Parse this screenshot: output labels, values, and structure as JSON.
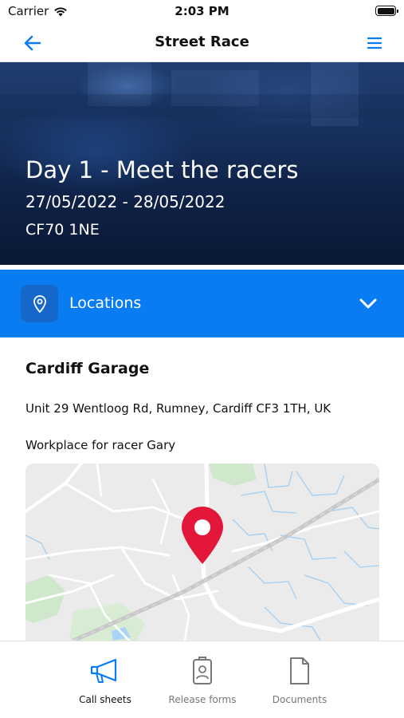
{
  "status_bar": {
    "carrier": "Carrier",
    "time": "2:03 PM"
  },
  "nav": {
    "title": "Street Race",
    "back_icon": "arrow-left-icon",
    "menu_icon": "hamburger-menu-icon"
  },
  "hero": {
    "title": "Day 1 - Meet the racers",
    "dates": "27/05/2022 - 28/05/2022",
    "postcode": "CF70 1NE"
  },
  "section": {
    "label": "Locations",
    "icon": "map-pin-icon",
    "expanded": true,
    "accent_color": "#0a7cf2"
  },
  "location": {
    "name": "Cardiff Garage",
    "address": "Unit 29 Wentloog Rd, Rumney, Cardiff CF3 1TH, UK",
    "note": "Workplace for racer Gary",
    "marker_color": "#e3173a"
  },
  "tabs": [
    {
      "label": "Call sheets",
      "icon": "megaphone-icon",
      "active": true
    },
    {
      "label": "Release forms",
      "icon": "id-badge-icon",
      "active": false
    },
    {
      "label": "Documents",
      "icon": "document-icon",
      "active": false
    }
  ]
}
